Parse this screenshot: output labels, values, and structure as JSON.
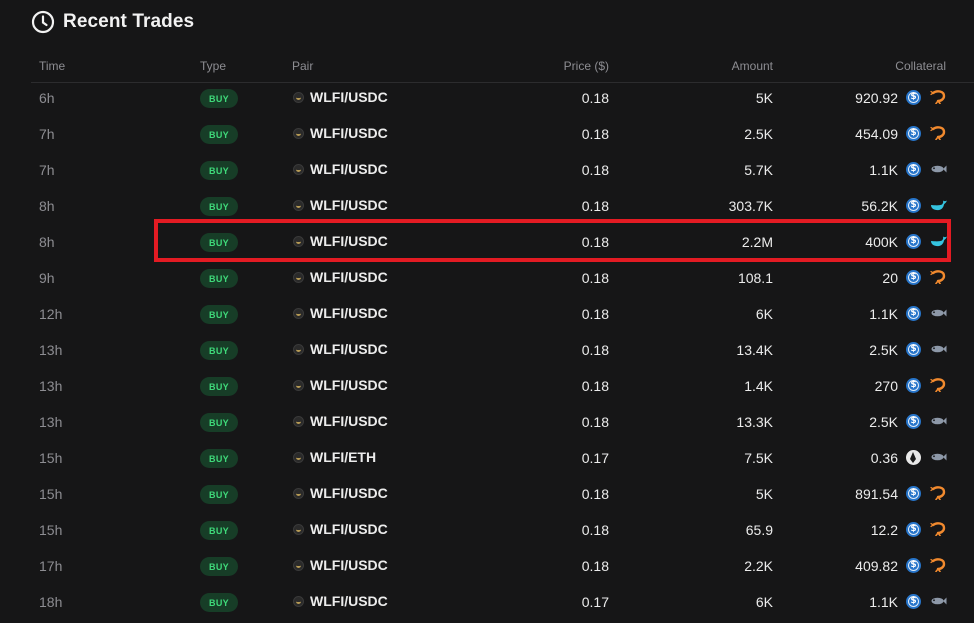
{
  "panel": {
    "title": "Recent Trades",
    "title_icon": "clock-icon"
  },
  "columns": {
    "time": "Time",
    "type": "Type",
    "pair": "Pair",
    "price": "Price ($)",
    "amount": "Amount",
    "collateral": "Collateral"
  },
  "colors": {
    "buy_badge_bg": "#173d27",
    "buy_badge_text": "#3fd97a",
    "highlight_border": "#e31b23",
    "shrimp": "#f28a2e",
    "fish": "#8d98a8",
    "whale": "#35c4e0"
  },
  "highlighted_row_index": 4,
  "trades": [
    {
      "time": "6h",
      "type": "BUY",
      "pair": "WLFI/USDC",
      "price": "0.18",
      "amount": "5K",
      "collateral": "920.92",
      "coin": "usdc",
      "size": "shrimp"
    },
    {
      "time": "7h",
      "type": "BUY",
      "pair": "WLFI/USDC",
      "price": "0.18",
      "amount": "2.5K",
      "collateral": "454.09",
      "coin": "usdc",
      "size": "shrimp"
    },
    {
      "time": "7h",
      "type": "BUY",
      "pair": "WLFI/USDC",
      "price": "0.18",
      "amount": "5.7K",
      "collateral": "1.1K",
      "coin": "usdc",
      "size": "fish"
    },
    {
      "time": "8h",
      "type": "BUY",
      "pair": "WLFI/USDC",
      "price": "0.18",
      "amount": "303.7K",
      "collateral": "56.2K",
      "coin": "usdc",
      "size": "whale"
    },
    {
      "time": "8h",
      "type": "BUY",
      "pair": "WLFI/USDC",
      "price": "0.18",
      "amount": "2.2M",
      "collateral": "400K",
      "coin": "usdc",
      "size": "whale"
    },
    {
      "time": "9h",
      "type": "BUY",
      "pair": "WLFI/USDC",
      "price": "0.18",
      "amount": "108.1",
      "collateral": "20",
      "coin": "usdc",
      "size": "shrimp"
    },
    {
      "time": "12h",
      "type": "BUY",
      "pair": "WLFI/USDC",
      "price": "0.18",
      "amount": "6K",
      "collateral": "1.1K",
      "coin": "usdc",
      "size": "fish"
    },
    {
      "time": "13h",
      "type": "BUY",
      "pair": "WLFI/USDC",
      "price": "0.18",
      "amount": "13.4K",
      "collateral": "2.5K",
      "coin": "usdc",
      "size": "fish"
    },
    {
      "time": "13h",
      "type": "BUY",
      "pair": "WLFI/USDC",
      "price": "0.18",
      "amount": "1.4K",
      "collateral": "270",
      "coin": "usdc",
      "size": "shrimp"
    },
    {
      "time": "13h",
      "type": "BUY",
      "pair": "WLFI/USDC",
      "price": "0.18",
      "amount": "13.3K",
      "collateral": "2.5K",
      "coin": "usdc",
      "size": "fish"
    },
    {
      "time": "15h",
      "type": "BUY",
      "pair": "WLFI/ETH",
      "price": "0.17",
      "amount": "7.5K",
      "collateral": "0.36",
      "coin": "eth",
      "size": "fish"
    },
    {
      "time": "15h",
      "type": "BUY",
      "pair": "WLFI/USDC",
      "price": "0.18",
      "amount": "5K",
      "collateral": "891.54",
      "coin": "usdc",
      "size": "shrimp"
    },
    {
      "time": "15h",
      "type": "BUY",
      "pair": "WLFI/USDC",
      "price": "0.18",
      "amount": "65.9",
      "collateral": "12.2",
      "coin": "usdc",
      "size": "shrimp"
    },
    {
      "time": "17h",
      "type": "BUY",
      "pair": "WLFI/USDC",
      "price": "0.18",
      "amount": "2.2K",
      "collateral": "409.82",
      "coin": "usdc",
      "size": "shrimp"
    },
    {
      "time": "18h",
      "type": "BUY",
      "pair": "WLFI/USDC",
      "price": "0.17",
      "amount": "6K",
      "collateral": "1.1K",
      "coin": "usdc",
      "size": "fish"
    }
  ]
}
